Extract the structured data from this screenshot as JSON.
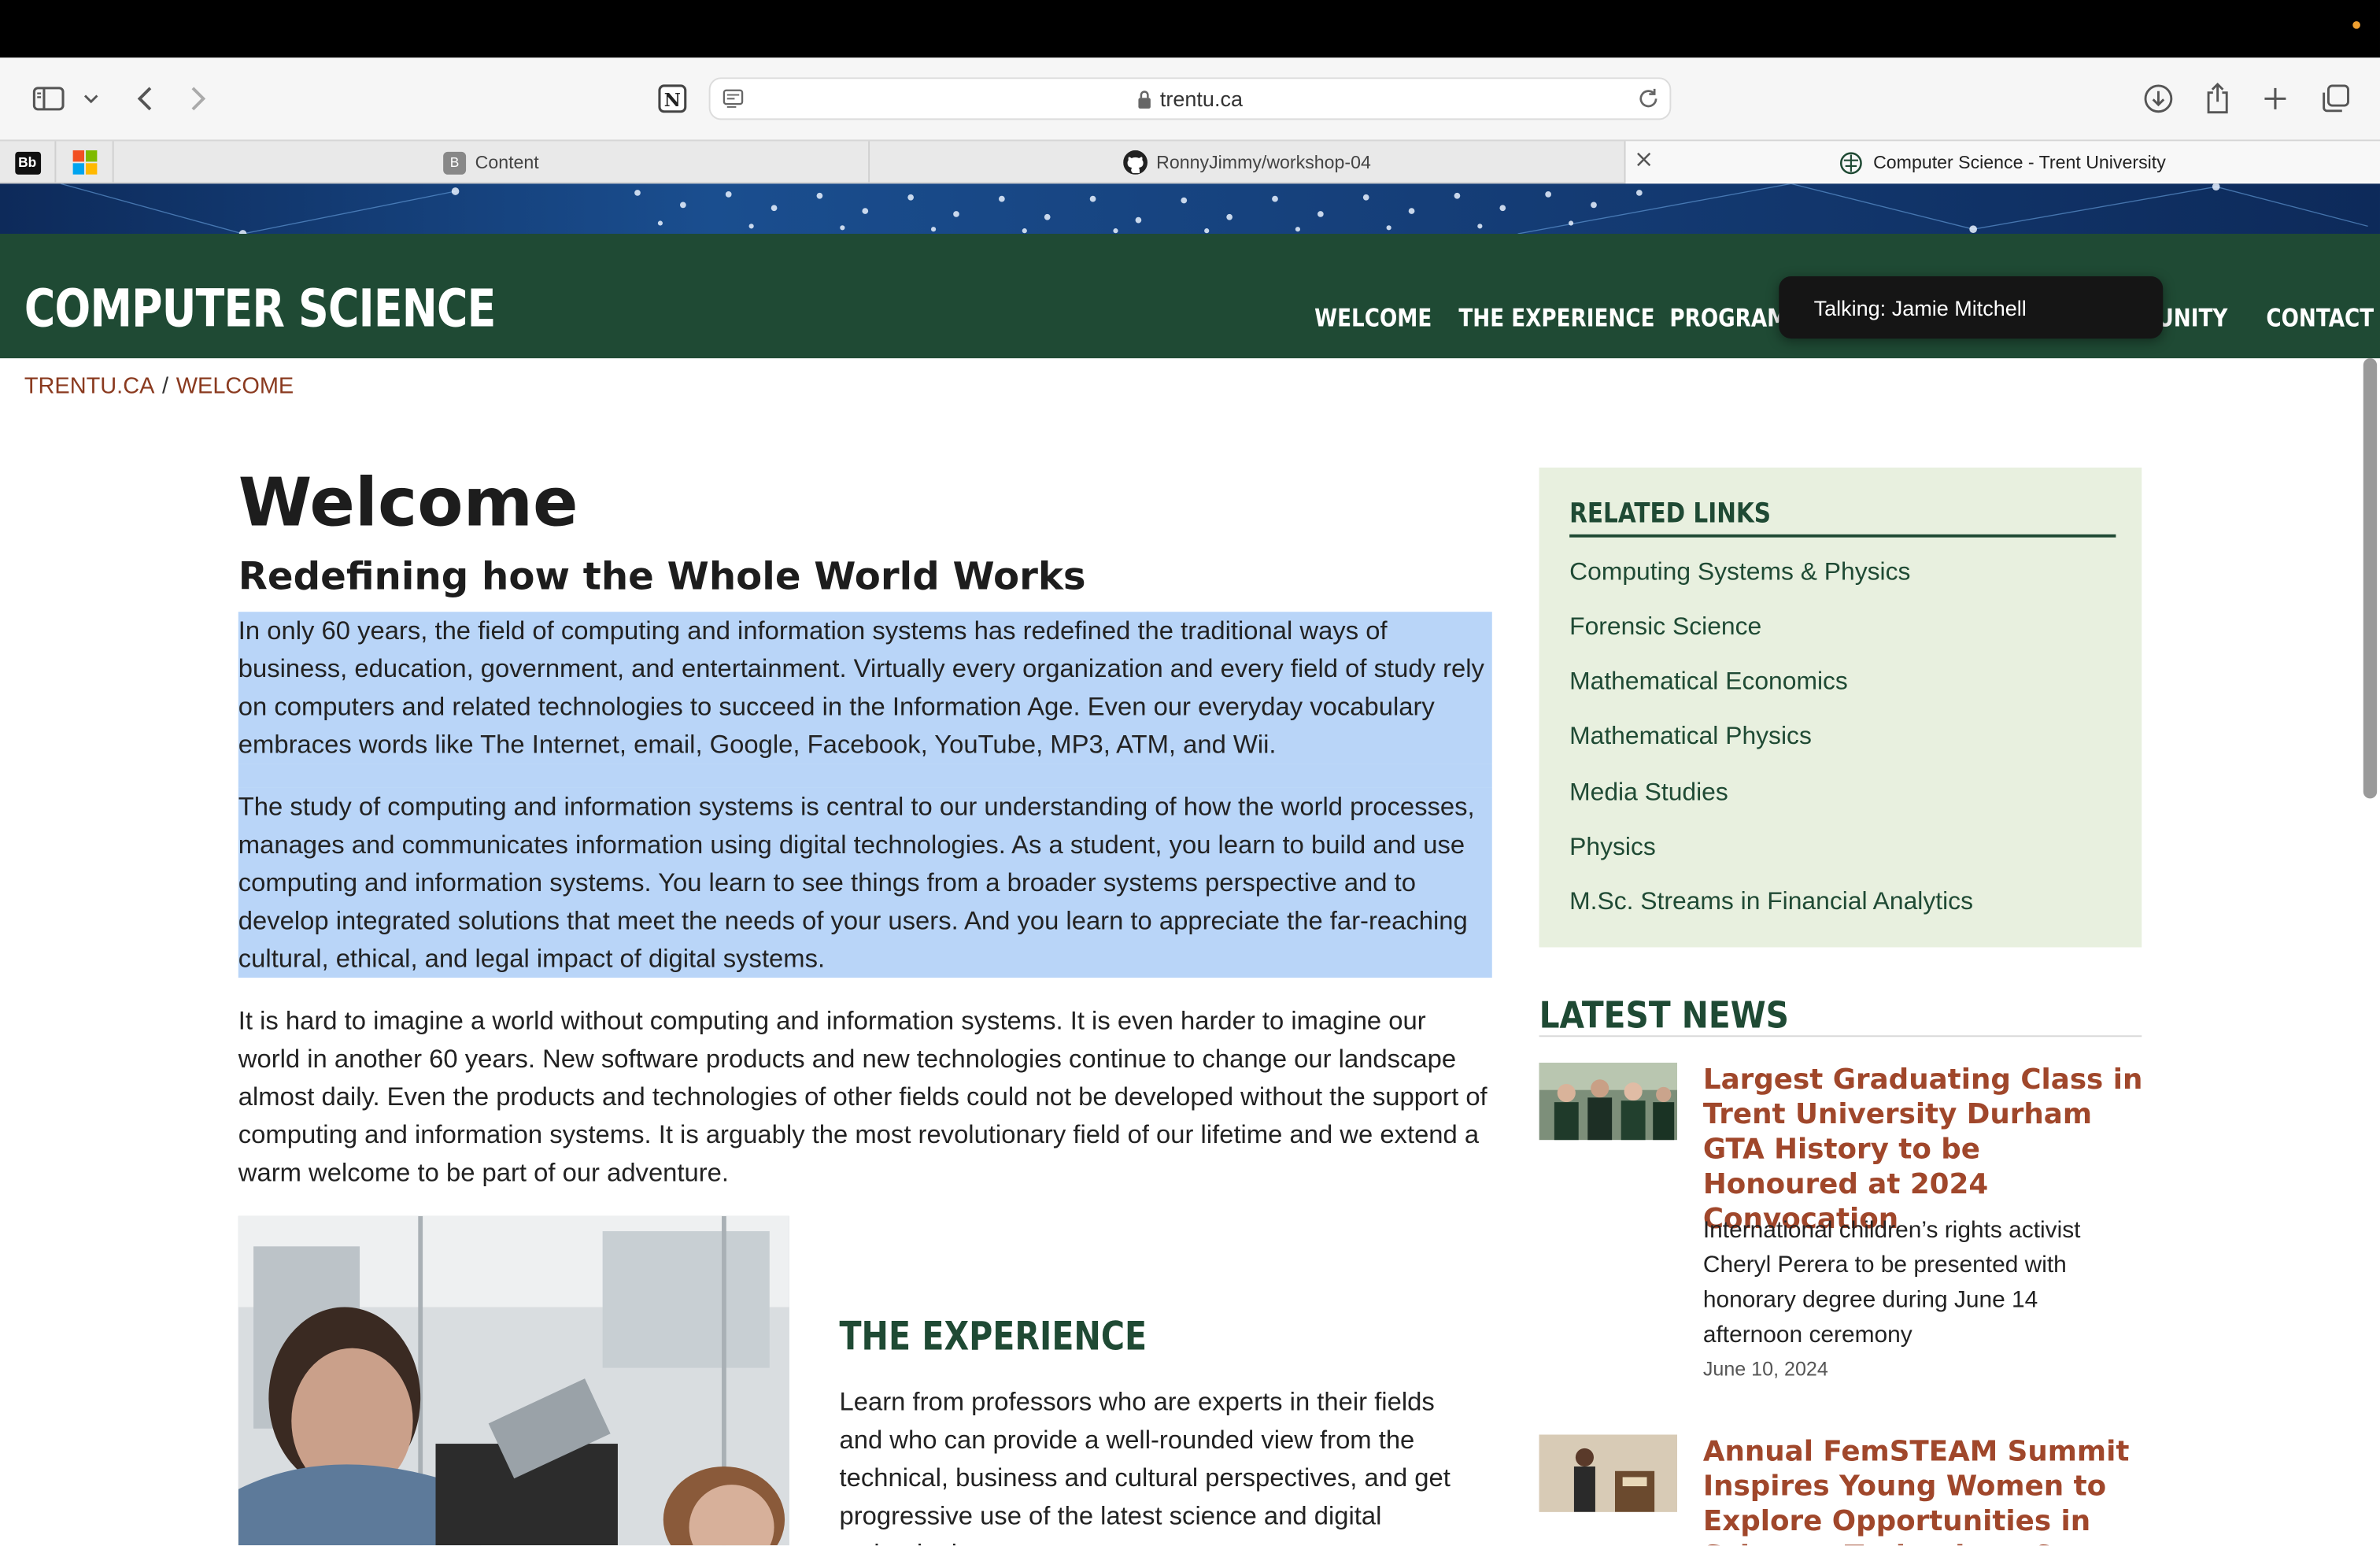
{
  "browser": {
    "url": "trentu.ca",
    "tabs": [
      {
        "label": "Content",
        "favicon": "B"
      },
      {
        "label": "RonnyJimmy/workshop-04"
      },
      {
        "label": "Computer Science - Trent University"
      }
    ],
    "pinned": [
      {
        "label": "Bb"
      }
    ]
  },
  "site": {
    "title": "COMPUTER SCIENCE",
    "nav": [
      "WELCOME",
      "THE EXPERIENCE",
      "PROGRAMS",
      "UNITY",
      "CONTACT"
    ],
    "tooltip": "Talking: Jamie Mitchell"
  },
  "breadcrumb": [
    "TRENTU.CA",
    "/",
    "WELCOME"
  ],
  "main": {
    "title": "Welcome",
    "subtitle": "Redefining how the Whole World Works",
    "paragraphs": [
      "In only 60 years, the field of computing and information systems has redefined the traditional ways of business, education, government, and entertainment.  Virtually every organization and every field of study rely on computers and related technologies to succeed in the Information Age.  Even our everyday vocabulary embraces words like The Internet, email, Google, Facebook, YouTube, MP3, ATM, and Wii.",
      "The study of computing and information systems is central to our understanding of how the world processes, manages and communicates information using digital technologies.  As a student, you learn to build and use computing and information systems.  You learn to see things from a broader systems perspective and to develop integrated solutions that meet the needs of your users.  And you learn to appreciate the far-reaching cultural, ethical, and legal impact of digital systems.",
      "It is hard to imagine a world without computing and information systems.  It is even harder to imagine our world in another 60 years.  New software products and new technologies continue to change our landscape almost daily.  Even the products and technologies of other fields could not be developed without the support of computing and information systems.  It is arguably the most revolutionary field of our lifetime and we extend a warm welcome to be part of our adventure."
    ],
    "experience_title": "THE EXPERIENCE",
    "experience_text": "Learn from professors who are experts in their fields and who can provide a well-rounded view from the technical, business and cultural perspectives, and get progressive use of the latest science and digital technologies."
  },
  "sidebar": {
    "related_title": "RELATED LINKS",
    "related_links": [
      "Computing Systems & Physics",
      "Forensic Science",
      "Mathematical Economics",
      "Mathematical Physics",
      "Media Studies",
      "Physics",
      "M.Sc. Streams in Financial Analytics"
    ],
    "news_title": "LATEST NEWS",
    "news": [
      {
        "headline": "Largest Graduating Class in Trent University Durham GTA History to be Honoured at 2024 Convocation",
        "summary": "International children’s rights activist Cheryl Perera to be presented with honorary degree during June 14 afternoon ceremony",
        "date": "June 10, 2024"
      },
      {
        "headline": "Annual FemSTEAM Summit Inspires Young Women to Explore Opportunities in Science, Technology & Engineering",
        "summary": "",
        "date": ""
      }
    ]
  },
  "colors": {
    "header_green": "#1f4a34",
    "link_rust": "#a0472b",
    "related_bg": "#e8f0df",
    "selection_blue": "#b9d5f8"
  }
}
